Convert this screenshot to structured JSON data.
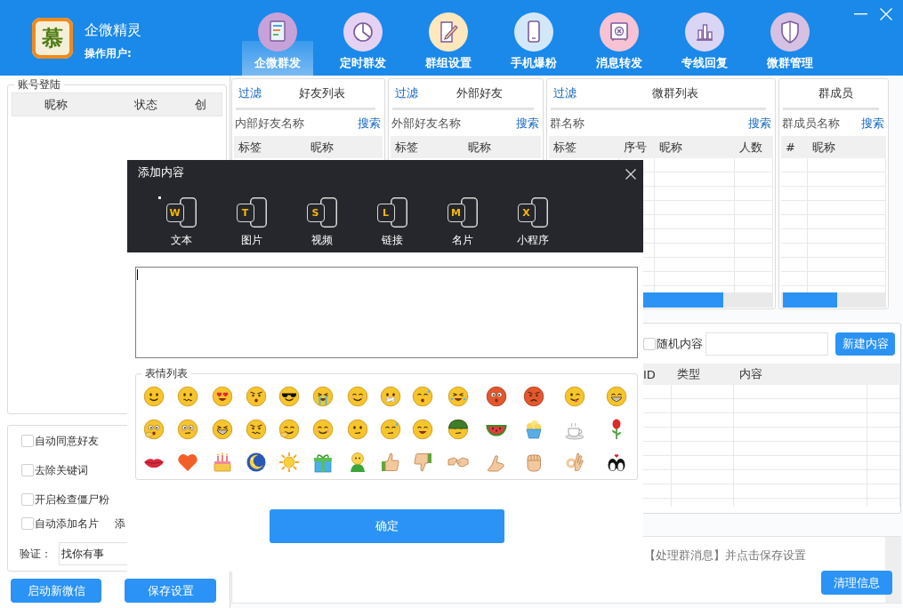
{
  "window": {
    "logo": "慕",
    "title": "企微精灵",
    "user_label": "操作用户:",
    "nav": [
      {
        "label": "企微群发",
        "selected": true
      },
      {
        "label": "定时群发",
        "selected": false
      },
      {
        "label": "群组设置",
        "selected": false
      },
      {
        "label": "手机爆粉",
        "selected": false
      },
      {
        "label": "消息转发",
        "selected": false
      },
      {
        "label": "专线回复",
        "selected": false
      },
      {
        "label": "微群管理",
        "selected": false
      }
    ]
  },
  "account_panel": {
    "title": "账号登陆",
    "columns": [
      "昵称",
      "状态",
      "创"
    ]
  },
  "options": [
    {
      "label": "自动同意好友",
      "checked": false
    },
    {
      "label": "去除关键词",
      "checked": false
    },
    {
      "label": "开启检查僵尸粉",
      "checked": false
    },
    {
      "label": "自动添加名片",
      "checked": false,
      "note": "添"
    }
  ],
  "verify": {
    "label": "验证：",
    "value": "找你有事"
  },
  "left_buttons": [
    "启动新微信",
    "保存设置"
  ],
  "lists": [
    {
      "filter": "过滤",
      "title": "好友列表",
      "search_placeholder": "内部好友名称",
      "search_button": "搜索",
      "columns": [
        "标签",
        "昵称"
      ]
    },
    {
      "filter": "过滤",
      "title": "外部好友",
      "search_placeholder": "外部好友名称",
      "search_button": "搜索",
      "columns": [
        "标签",
        "昵称"
      ]
    },
    {
      "filter": "过滤",
      "title": "微群列表",
      "search_placeholder": "群名称",
      "search_button": "搜索",
      "columns": [
        "标签",
        "序号",
        "昵称",
        "人数"
      ]
    },
    {
      "title": "群成员",
      "search_placeholder": "群成员名称",
      "search_button": "搜索",
      "columns": [
        "#",
        "昵称"
      ]
    }
  ],
  "content_panel": {
    "random": {
      "label": "随机内容",
      "checked": false
    },
    "new_button": "新建内容",
    "columns": [
      "ID",
      "类型",
      "内容"
    ]
  },
  "info_panel": {
    "message": "【处理群消息】并点击保存设置",
    "clear_button": "清理信息"
  },
  "dialog": {
    "title": "添加内容",
    "tools": [
      {
        "letter": "W",
        "label": "文本"
      },
      {
        "letter": "T",
        "label": "图片"
      },
      {
        "letter": "S",
        "label": "视频"
      },
      {
        "letter": "L",
        "label": "链接"
      },
      {
        "letter": "M",
        "label": "名片"
      },
      {
        "letter": "X",
        "label": "小程序"
      }
    ],
    "emoji_title": "表情列表",
    "confirm": "确定"
  }
}
